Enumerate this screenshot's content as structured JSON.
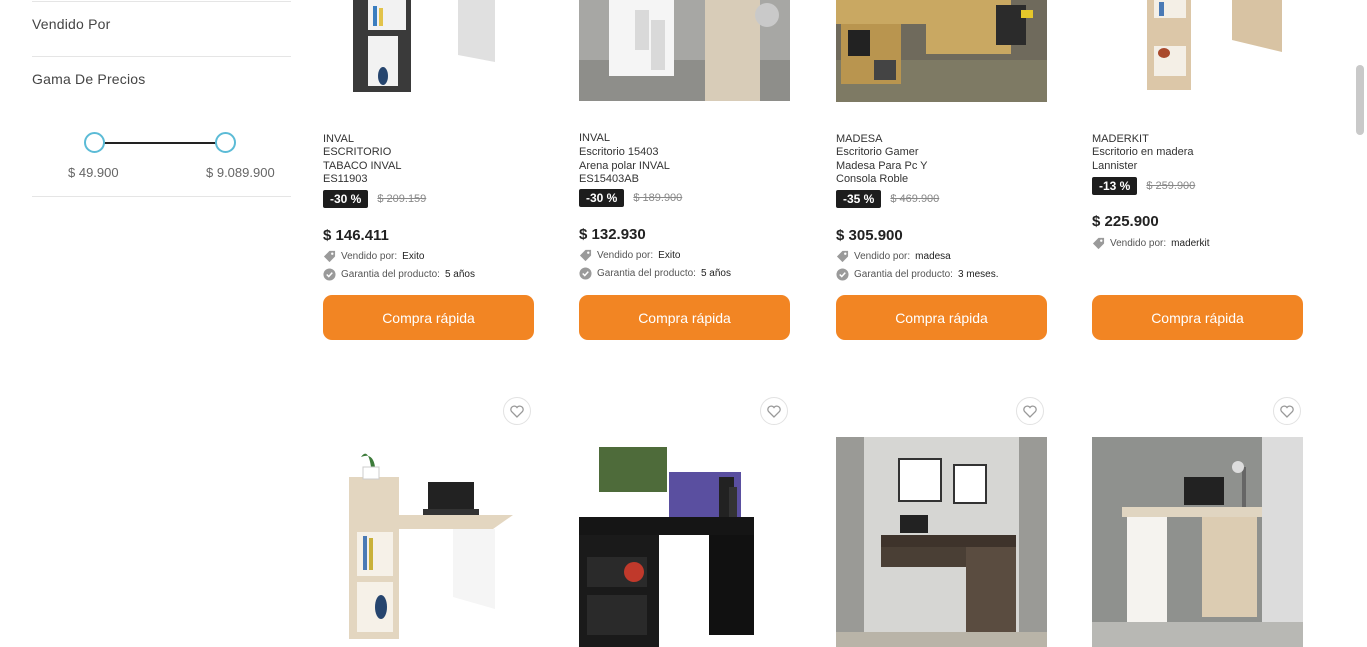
{
  "sidebar": {
    "sold_by_title": "Vendido Por",
    "price_range_title": "Gama De Precios",
    "price_min": "$ 49.900",
    "price_max": "$ 9.089.900"
  },
  "products_row1": [
    {
      "brand": "INVAL",
      "name": "ESCRITORIO TABACO INVAL ES11903",
      "discount": "-30 %",
      "old_price": "$ 209.159",
      "price": "$ 146.411",
      "sold_by_label": "Vendido por:",
      "sold_by": "Exito",
      "warranty_label": "Garantia del producto:",
      "warranty": "5 años",
      "button": "Compra rápida"
    },
    {
      "brand": "INVAL",
      "name": "Escritorio 15403 Arena polar INVAL ES15403AB",
      "discount": "-30 %",
      "old_price": "$ 189.900",
      "price": "$ 132.930",
      "sold_by_label": "Vendido por:",
      "sold_by": "Exito",
      "warranty_label": "Garantia del producto:",
      "warranty": "5 años",
      "button": "Compra rápida"
    },
    {
      "brand": "MADESA",
      "name": "Escritorio Gamer Madesa Para Pc Y Consola Roble",
      "discount": "-35 %",
      "old_price": "$ 469.900",
      "price": "$ 305.900",
      "sold_by_label": "Vendido por:",
      "sold_by": "madesa",
      "warranty_label": "Garantia del producto:",
      "warranty": "3 meses.",
      "button": "Compra rápida"
    },
    {
      "brand": "MADERKIT",
      "name": "Escritorio en madera Lannister",
      "discount": "-13 %",
      "old_price": "$ 259.900",
      "price": "$ 225.900",
      "sold_by_label": "Vendido por:",
      "sold_by": "maderkit",
      "button": "Compra rápida"
    }
  ],
  "colors": {
    "accent": "#f28523",
    "slider": "#5bbbd6",
    "badge": "#1d1d1d"
  },
  "icons": [
    "tag-icon",
    "check-badge-icon",
    "heart-icon"
  ]
}
